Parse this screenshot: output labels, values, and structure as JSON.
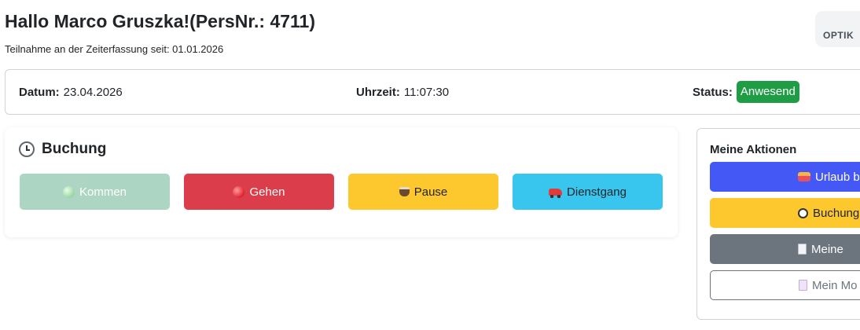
{
  "header": {
    "greeting": "Hallo Marco Gruszka!(PersNr.: 4711)",
    "subtitle": "Teilnahme an der Zeiterfassung seit: 01.01.2026",
    "optik_label": "OPTIK"
  },
  "infobar": {
    "date_label": "Datum:",
    "date_value": "23.04.2026",
    "time_label": "Uhrzeit:",
    "time_value": "11:07:30",
    "status_label": "Status:",
    "status_value": "Anwesend",
    "status_color": "#1f9d45"
  },
  "booking": {
    "title": "Buchung",
    "icon": "clock-icon",
    "buttons": [
      {
        "label": "Kommen",
        "icon": "green-circle-icon",
        "color": "#acd5c4"
      },
      {
        "label": "Gehen",
        "icon": "red-circle-icon",
        "color": "#dc3d4a"
      },
      {
        "label": "Pause",
        "icon": "coffee-icon",
        "color": "#fdc72e"
      },
      {
        "label": "Dienstgang",
        "icon": "car-icon",
        "color": "#38c6ef"
      }
    ]
  },
  "actions": {
    "title": "Meine Aktionen",
    "buttons": [
      {
        "label": "Urlaub b",
        "icon": "suitcase-icon",
        "color": "#4458f5"
      },
      {
        "label": "Buchung",
        "icon": "stopwatch-icon",
        "color": "#fdc72e"
      },
      {
        "label": "Meine",
        "icon": "document-icon",
        "color": "#6c757d"
      },
      {
        "label": "Mein Mo",
        "icon": "document-icon",
        "color": "#6c757d"
      }
    ]
  }
}
